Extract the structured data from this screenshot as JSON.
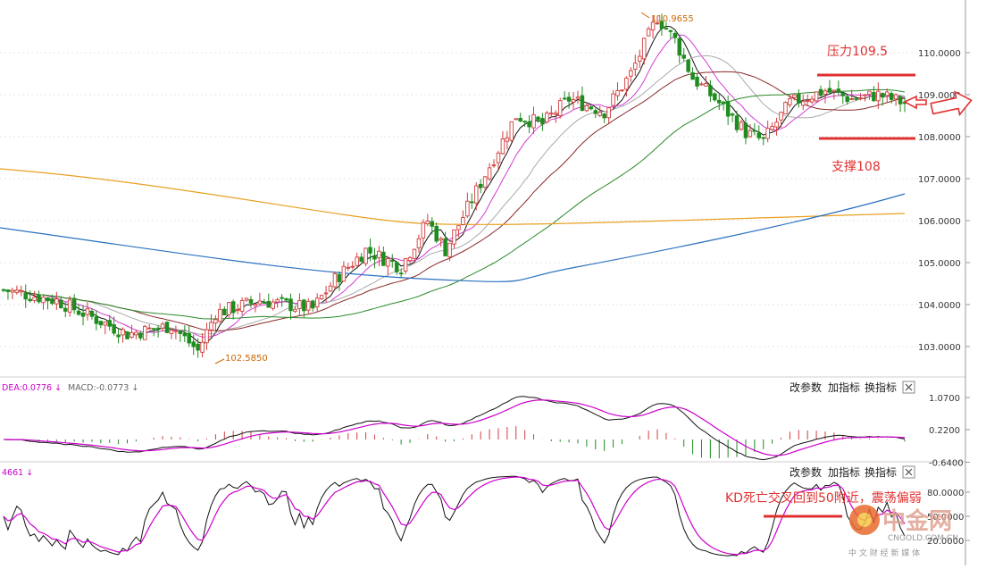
{
  "chart_data": [
    {
      "type": "candlestick",
      "name_panel": "price",
      "ylim": [
        102.4,
        111.1
      ],
      "y_ticks": [
        "110.0000",
        "109.0000",
        "108.0000",
        "107.0000",
        "106.0000",
        "105.0000",
        "104.0000",
        "103.0000"
      ],
      "y_tick_values": [
        110,
        109,
        108,
        107,
        106,
        105,
        104,
        103
      ],
      "high_label": "110.9655",
      "low_label": "102.5850",
      "annotations": {
        "resistance": {
          "text": "压力109.5",
          "value": 109.5
        },
        "support": {
          "text": "支撑108",
          "value": 108.0
        }
      },
      "colors": {
        "up": "#d23c3c",
        "down": "#1e8c1e"
      }
    },
    {
      "type": "macd",
      "header_dea": "DEA:0.0776 ↓",
      "header_macd": "MACD:-0.0773 ↓",
      "y_ticks": [
        "1.0700",
        "0.2200",
        "-0.6400"
      ],
      "y_tick_values": [
        1.07,
        0.22,
        -0.64
      ],
      "controls": [
        "改参数",
        "加指标",
        "换指标"
      ]
    },
    {
      "type": "kdj",
      "header_value": "4661 ↓",
      "y_ticks": [
        "80.0000",
        "50.0000",
        "20.0000"
      ],
      "y_tick_values": [
        80,
        50,
        20
      ],
      "annotation": "KD死亡交叉回到50附近，震荡偏弱",
      "controls": [
        "改参数",
        "加指标",
        "换指标"
      ]
    }
  ],
  "watermark": {
    "brand": "中金网",
    "domain": "CNGOLD.COM.CN",
    "slogan": "中 文 财 经 新 媒 体"
  }
}
